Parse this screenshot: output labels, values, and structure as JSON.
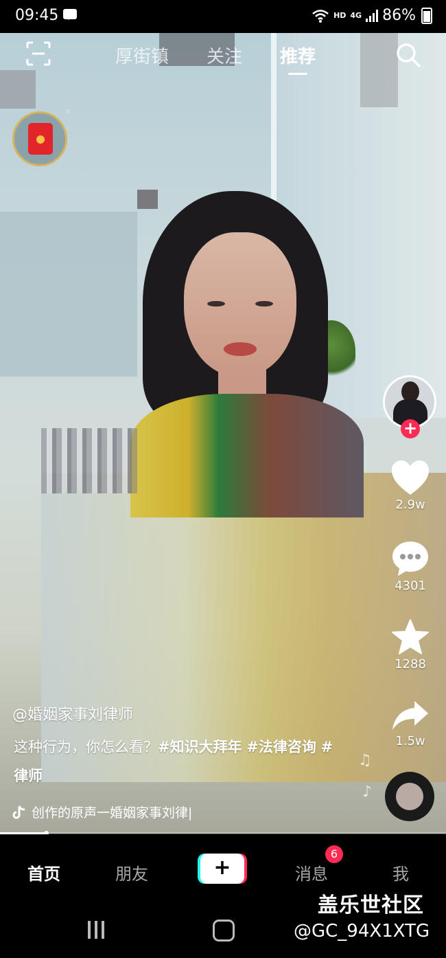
{
  "status_bar": {
    "time": "09:45",
    "network": "HD",
    "network_gen": "4G",
    "battery": "86%",
    "icons": [
      "message-icon",
      "wifi-icon",
      "signal-icon",
      "battery-icon"
    ]
  },
  "top_nav": {
    "tabs": [
      {
        "label": "厚街镇",
        "active": false
      },
      {
        "label": "关注",
        "active": false
      },
      {
        "label": "推荐",
        "active": true
      }
    ],
    "icons": [
      "scan-icon",
      "search-icon"
    ]
  },
  "red_packet": {
    "close": "×"
  },
  "right_rail": {
    "like_count": "2.9w",
    "comment_count": "4301",
    "favorite_count": "1288",
    "share_count": "1.5w",
    "follow_symbol": "+"
  },
  "video_info": {
    "author": "@婚姻家事刘律师",
    "desc_text": "这种行为，你怎么看？",
    "hashtags": [
      "#知识大拜年",
      "#法律咨询",
      "#律师"
    ],
    "music": "创作的原声一婚姻家事刘律|"
  },
  "bottom_nav": {
    "items": [
      "首页",
      "朋友",
      "消息",
      "我"
    ],
    "plus_symbol": "+",
    "message_badge": "6"
  },
  "watermark": {
    "line1": "盖乐世社区",
    "line2": "@GC_94X1XTG"
  },
  "colors": {
    "accent": "#fe2c55",
    "cyan": "#25f4ee",
    "bar": "#000000"
  }
}
